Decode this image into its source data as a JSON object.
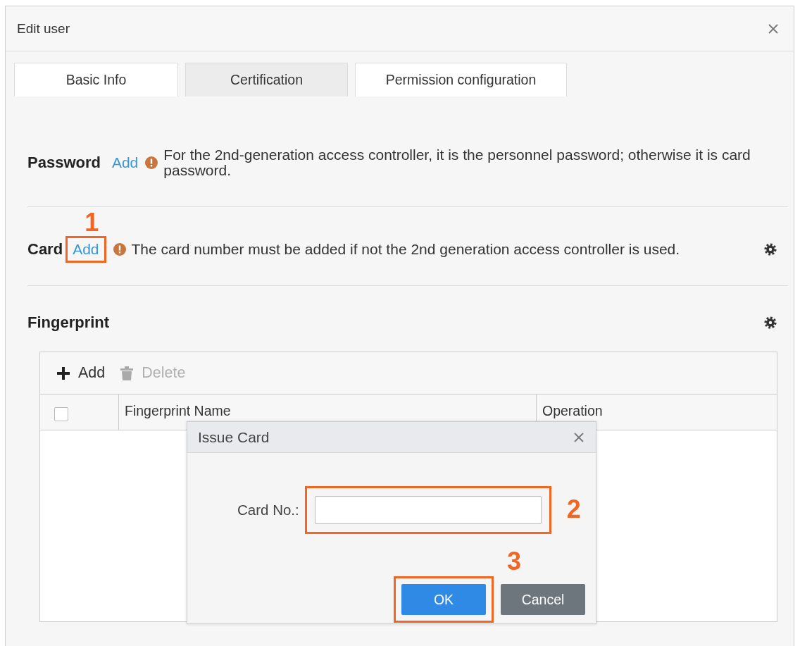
{
  "dialog": {
    "title": "Edit user"
  },
  "tabs": [
    {
      "label": "Basic Info",
      "selected": false
    },
    {
      "label": "Certification",
      "selected": true
    },
    {
      "label": "Permission configuration",
      "selected": false
    }
  ],
  "sections": [
    {
      "kind": "note",
      "title": "Password",
      "action": "Add",
      "note": "For the 2nd-generation access controller, it is the personnel password; otherwise it is card password.",
      "settings": false
    },
    {
      "kind": "note",
      "title": "Card",
      "action": "Add",
      "note": "The card number must be added if not the 2nd generation access controller is used.",
      "settings": true
    },
    {
      "kind": "table",
      "title": "Fingerprint",
      "settings": true,
      "toolbar": [
        {
          "label": "Add",
          "kind": "add",
          "disabled": false
        },
        {
          "label": "Delete",
          "kind": "delete",
          "disabled": true
        }
      ],
      "select_all": {
        "checked": false
      },
      "columns": [
        "Fingerprint Name",
        "Operation"
      ]
    }
  ],
  "modal": {
    "title": "Issue Card",
    "field_label": "Card No.:",
    "buttons": [
      {
        "label": "OK",
        "kind": "primary"
      },
      {
        "label": "Cancel",
        "kind": "secondary"
      }
    ]
  },
  "callouts": [
    {
      "label": "1"
    },
    {
      "label": "2"
    },
    {
      "label": "3"
    }
  ]
}
